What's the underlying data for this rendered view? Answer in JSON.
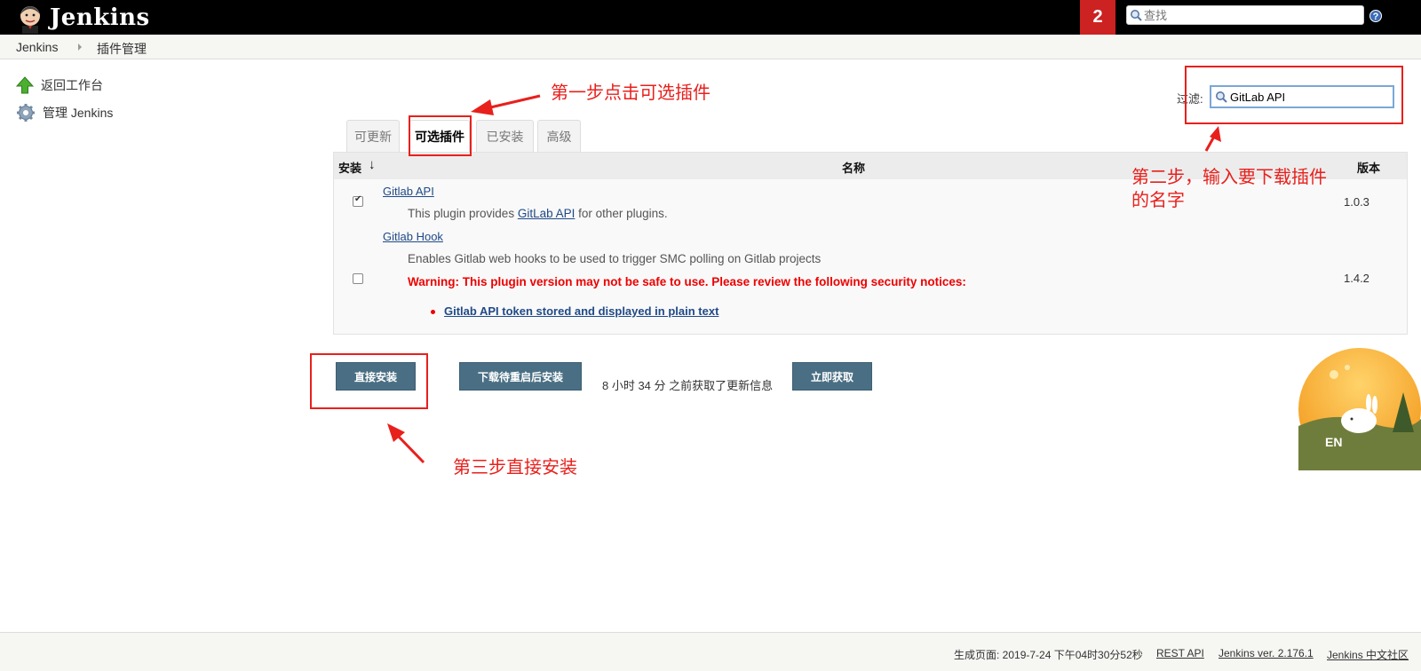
{
  "header": {
    "logo_text": "Jenkins",
    "notification_count": "2",
    "search_placeholder": "查找",
    "help_icon": "?"
  },
  "breadcrumb": {
    "items": [
      "Jenkins",
      "插件管理"
    ]
  },
  "side_panel": {
    "items": [
      {
        "label": "返回工作台",
        "icon": "up-arrow-icon"
      },
      {
        "label": "管理 Jenkins",
        "icon": "gear-icon"
      }
    ]
  },
  "tabs": [
    {
      "label": "可更新",
      "active": false
    },
    {
      "label": "可选插件",
      "active": true
    },
    {
      "label": "已安装",
      "active": false
    },
    {
      "label": "高级",
      "active": false
    }
  ],
  "filter": {
    "label": "过滤:",
    "value": "GitLab API"
  },
  "table": {
    "headers": {
      "install": "安装",
      "sort_arrow": "↓",
      "name": "名称",
      "version": "版本"
    },
    "rows": [
      {
        "checked": true,
        "name": "Gitlab API",
        "desc_pre": "This plugin provides ",
        "desc_link": "GitLab API",
        "desc_post": " for other plugins.",
        "version": "1.0.3"
      },
      {
        "checked": false,
        "name": "Gitlab Hook",
        "desc": "Enables Gitlab web hooks to be used to trigger SMC polling on Gitlab projects",
        "warning": "Warning: This plugin version may not be safe to use. Please review the following security notices:",
        "notice_link": "Gitlab API token stored and displayed in plain text",
        "version": "1.4.2"
      }
    ]
  },
  "actions": {
    "install_now": "直接安装",
    "install_after_restart": "下载待重启后安装",
    "update_info": "8 小时 34 分 之前获取了更新信息",
    "check_now": "立即获取"
  },
  "annotations": {
    "step1": "第一步点击可选插件",
    "step2_line1": "第二步，输入要下载插件",
    "step2_line2": "的名字",
    "step3": "第三步直接安装"
  },
  "mascot": {
    "text": "EN"
  },
  "footer": {
    "generated": "生成页面: 2019-7-24 下午04时30分52秒",
    "rest_api": "REST API",
    "version": "Jenkins ver. 2.176.1",
    "community": "Jenkins 中文社区"
  },
  "colors": {
    "annotation_red": "#e8201c",
    "button_bg": "#4a6f84",
    "header_bg": "#000000",
    "notification_bg": "#cc2222"
  }
}
